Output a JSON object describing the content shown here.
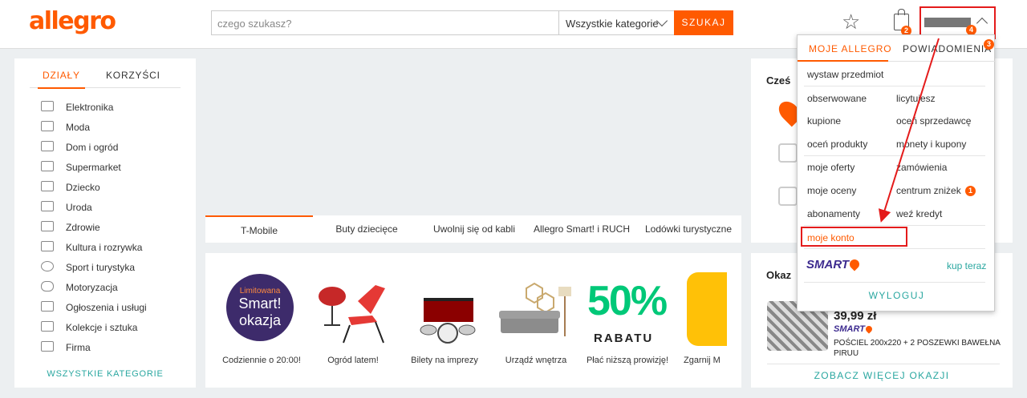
{
  "header": {
    "logo": "allegro",
    "search_placeholder": "czego szukasz?",
    "category_select": "Wszystkie kategorie",
    "search_button": "SZUKAJ",
    "cart_badge": "2",
    "user_badge": "4"
  },
  "left_panel": {
    "tab_active": "DZIAŁY",
    "tab_inactive": "KORZYŚCI",
    "categories": [
      "Elektronika",
      "Moda",
      "Dom i ogród",
      "Supermarket",
      "Dziecko",
      "Uroda",
      "Zdrowie",
      "Kultura i rozrywka",
      "Sport i turystyka",
      "Motoryzacja",
      "Ogłoszenia i usługi",
      "Kolekcje i sztuka",
      "Firma"
    ],
    "all_categories": "WSZYSTKIE KATEGORIE"
  },
  "promo_tabs": [
    "T-Mobile",
    "Buty dziecięce",
    "Uwolnij się od kabli",
    "Allegro Smart! i RUCH",
    "Lodówki turystyczne"
  ],
  "tiles": [
    {
      "caption": "Codziennie o 20:00!",
      "badge_top": "Limitowana",
      "badge_line1": "Smart!",
      "badge_line2": "okazja"
    },
    {
      "caption": "Ogród latem!"
    },
    {
      "caption": "Bilety na imprezy"
    },
    {
      "caption": "Urządź wnętrza"
    },
    {
      "caption": "Płać niższą prowizję!",
      "big": "50%",
      "sub": "RABATU"
    },
    {
      "caption": "Zgarnij M"
    }
  ],
  "right_top": {
    "title": "Cześ"
  },
  "right_bottom": {
    "title": "Okaz",
    "price": "39,99 zł",
    "smart": "SMART",
    "desc": "POŚCIEL 200x220 + 2 POSZEWKI BAWEŁNA PIRUU",
    "more": "ZOBACZ WIĘCEJ OKAZJI"
  },
  "dropdown": {
    "tab_active": "MOJE ALLEGRO",
    "tab_inactive": "POWIADOMIENIA",
    "tab_badge": "3",
    "wystaw": "wystaw przedmiot",
    "col1": [
      "obserwowane",
      "kupione",
      "oceń produkty"
    ],
    "col2": [
      "licytujesz",
      "oceń sprzedawcę",
      "monety i kupony"
    ],
    "col3": [
      "moje oferty",
      "moje oceny",
      "abonamenty"
    ],
    "col4": [
      "zamówienia",
      "centrum zniżek",
      "weź kredyt"
    ],
    "centrum_badge": "1",
    "moje_konto": "moje konto",
    "smart": "SMART",
    "kup_teraz": "kup teraz",
    "wyloguj": "WYLOGUJ"
  },
  "colors": {
    "accent": "#ff5a00",
    "teal": "#2aa7a0",
    "annotation": "#e41b1b"
  }
}
